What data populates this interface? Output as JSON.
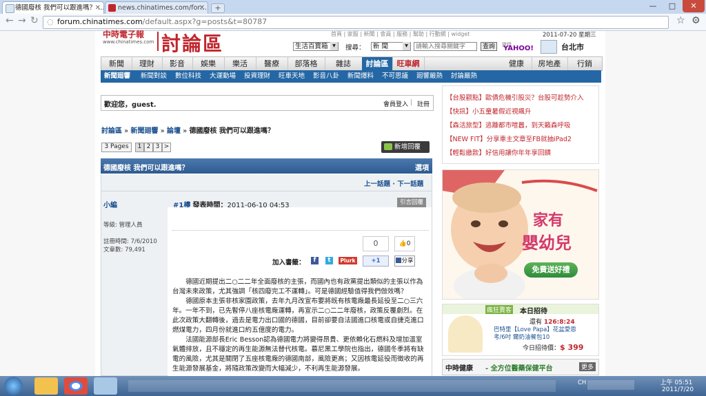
{
  "browser": {
    "tabs": [
      {
        "label": "德國廢核 我們可以跟進嗎？ …"
      },
      {
        "label": "news.chinatimes.com/for…"
      }
    ],
    "new_tab": "+",
    "window_controls": [
      "—",
      "□",
      "✕"
    ],
    "url_host": "forum.chinatimes.com",
    "url_path": "/default.aspx?g=posts&t=80787"
  },
  "header": {
    "logo_text": "中時電子報",
    "logo_sub": "www.chinatimes.com",
    "forum_title": "討論區",
    "top_links": "首頁 | 家服 | 新聞 | 會員 | 服務 | 幫助 | 行動網 | widget",
    "date": "2011-07-20 星期三",
    "category_select": "生活百寶箱",
    "search_label": "搜尋：",
    "search_scope": "新 聞",
    "search_placeholder": "請輸入搜尋關鍵字",
    "search_button": "查詢",
    "sponsor": "提供",
    "yahoo": "YAHOO!",
    "city": "台北市"
  },
  "main_nav": [
    "新聞",
    "理財",
    "影音",
    "娛樂",
    "樂活",
    "醫療",
    "部落格",
    "雜誌",
    "討論區",
    "旺車網",
    "健康",
    "房地產",
    "行銷"
  ],
  "sub_nav": [
    "新聞廻響",
    "新聞對談",
    "數位科技",
    "大運動場",
    "投資理財",
    "旺車天地",
    "影音八卦",
    "新聞爆料",
    "不可思議",
    "廻響嚴熱",
    "討論嚴熱"
  ],
  "welcome": {
    "text": "歡迎您，guest.",
    "login": "會員登入",
    "register": "註冊"
  },
  "breadcrumb": [
    "討論區",
    "新聞廻響",
    "論壇",
    "德國廢核 我們可以跟進嗎？"
  ],
  "pagination": {
    "total": "3 Pages",
    "pages": [
      "1",
      "2",
      "3",
      ">"
    ],
    "new_post": "新增回覆"
  },
  "thread": {
    "title": "德國廢核 我們可以跟進嗎？",
    "options": "選項",
    "prev": "上一話題",
    "next": "下一話題"
  },
  "post": {
    "author": "小編",
    "floor": "#1樓",
    "time_label": "發表時間：",
    "time": "2011-06-10 04:53",
    "quote": "引言回覆",
    "rank_label": "等級: 管理人員",
    "reg_label": "註冊時間: 7/6/2010",
    "count_label": "文章數: 79,491",
    "bookmark_label": "加入書籤：",
    "like_count": "0",
    "thumb_count": "0",
    "plurk": "Plurk",
    "plus_one": "+1",
    "share": "分享",
    "paragraphs": [
      "德國近期提出二○二二年全面廢核的主張，而國內也有政黨提出類似的主張以作為台灣未來政策，尤其強調「核四廢完工不運轉」。可是德國經驗值得我們倣效嗎？",
      "德國原本主張非核家園政策，去年九月改宣布要將既有核電廠最長延役至二○三六年。一年不到，已先暫停八座核電廠運轉，再宣示二○二二年廢核，政策反覆劇烈。在此次政策大翻轉後，過去是電力出口國的德國，目前卻要自法國進口核電或自捷克進口燃煤電力，四月份就進口約五億度的電力。",
      "法國能源部長Eric Besson認為德國電力將變得昂貴、更依賴化石燃料及增加溫室氣體排放，且不穩定的再生能源無法替代核電。慕尼黑工學院也指出，德國冬季將有缺電的風險，尤其是關閉了五座核電廠的德國南部，風險更高；又因核電延役而徵收的再生能源發展基金，將隨政策改變而大幅減少，不利再生能源發展。"
    ]
  },
  "sidebar": {
    "news_links": [
      {
        "tag": "【台股觀點】",
        "text": "歐債危機引股災？台股可趁勢介入"
      },
      {
        "tag": "【快訊】",
        "text": "小五童暑假近視飆升"
      },
      {
        "tag": "【森活旅型】",
        "text": "逃離都市喧囂，到天籟森呼吸"
      },
      {
        "tag": "【NEW FIT】",
        "text": "分享車主文章至FB就抽iPad2"
      },
      {
        "tag": "【輕鬆繳款】",
        "text": "好信用讓你年年享回饋"
      }
    ],
    "ad_title_1": "家有",
    "ad_title_2": "嬰幼兒",
    "ad_button": "免費送好禮",
    "promo_tag": "瘋狂賣客",
    "promo_title": "本日招待",
    "promo_timer_label": "還有",
    "promo_timer": "126:8:24",
    "promo_item_1": "巴特里【Love Papa】花盆愛恩",
    "promo_item_2": "考/6吋 爾奶油餐包10",
    "promo_price_label": "今日招待價：",
    "promo_price": "$ 399",
    "health_title": "中時健康",
    "health_sub": "- 全方位醫藥保健平台",
    "health_more": "更多"
  },
  "taskbar": {
    "lang": "CH",
    "time": "上午 05:51",
    "date": "2011/7/20"
  },
  "colors": {
    "accent_red": "#c0262d",
    "nav_blue": "#2467a4",
    "thread_bar": "#3b68a0"
  }
}
